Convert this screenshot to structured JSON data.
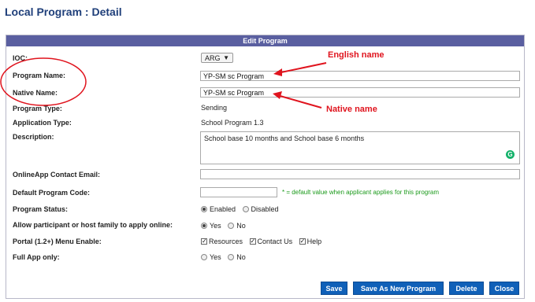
{
  "page": {
    "title": "Local Program : Detail"
  },
  "panel": {
    "header": "Edit Program",
    "labels": {
      "ioc": "IOC:",
      "program_name": "Program Name:",
      "native_name": "Native Name:",
      "program_type": "Program Type:",
      "application_type": "Application Type:",
      "description": "Description:",
      "online_email": "OnlineApp Contact Email:",
      "default_code": "Default Program Code:",
      "status": "Program Status:",
      "allow_apply": "Allow participant or host family to apply online:",
      "portal": "Portal (1.2+) Menu Enable:",
      "full_app": "Full App only:"
    },
    "values": {
      "ioc": "ARG",
      "program_name": "YP-SM sc Program",
      "native_name": "YP-SM sc Program",
      "program_type": "Sending",
      "application_type": "School Program 1.3",
      "description": "School base 10 months and School base 6 months",
      "online_email": "",
      "default_code": "",
      "default_code_hint": "* = default value when applicant applies for this program"
    },
    "options": {
      "status": [
        {
          "label": "Enabled",
          "selected": true
        },
        {
          "label": "Disabled",
          "selected": false
        }
      ],
      "allow_apply": [
        {
          "label": "Yes",
          "selected": true
        },
        {
          "label": "No",
          "selected": false
        }
      ],
      "portal": [
        {
          "label": "Resources",
          "checked": true
        },
        {
          "label": "Contact Us",
          "checked": true
        },
        {
          "label": "Help",
          "checked": true
        }
      ],
      "full_app": [
        {
          "label": "Yes",
          "selected": false
        },
        {
          "label": "No",
          "selected": false
        }
      ]
    },
    "buttons": {
      "save": "Save",
      "save_as_new": "Save As New Program",
      "delete": "Delete",
      "close": "Close"
    }
  },
  "annotations": {
    "english_name": "English name",
    "native_name": "Native name",
    "color": "#e0141e"
  }
}
